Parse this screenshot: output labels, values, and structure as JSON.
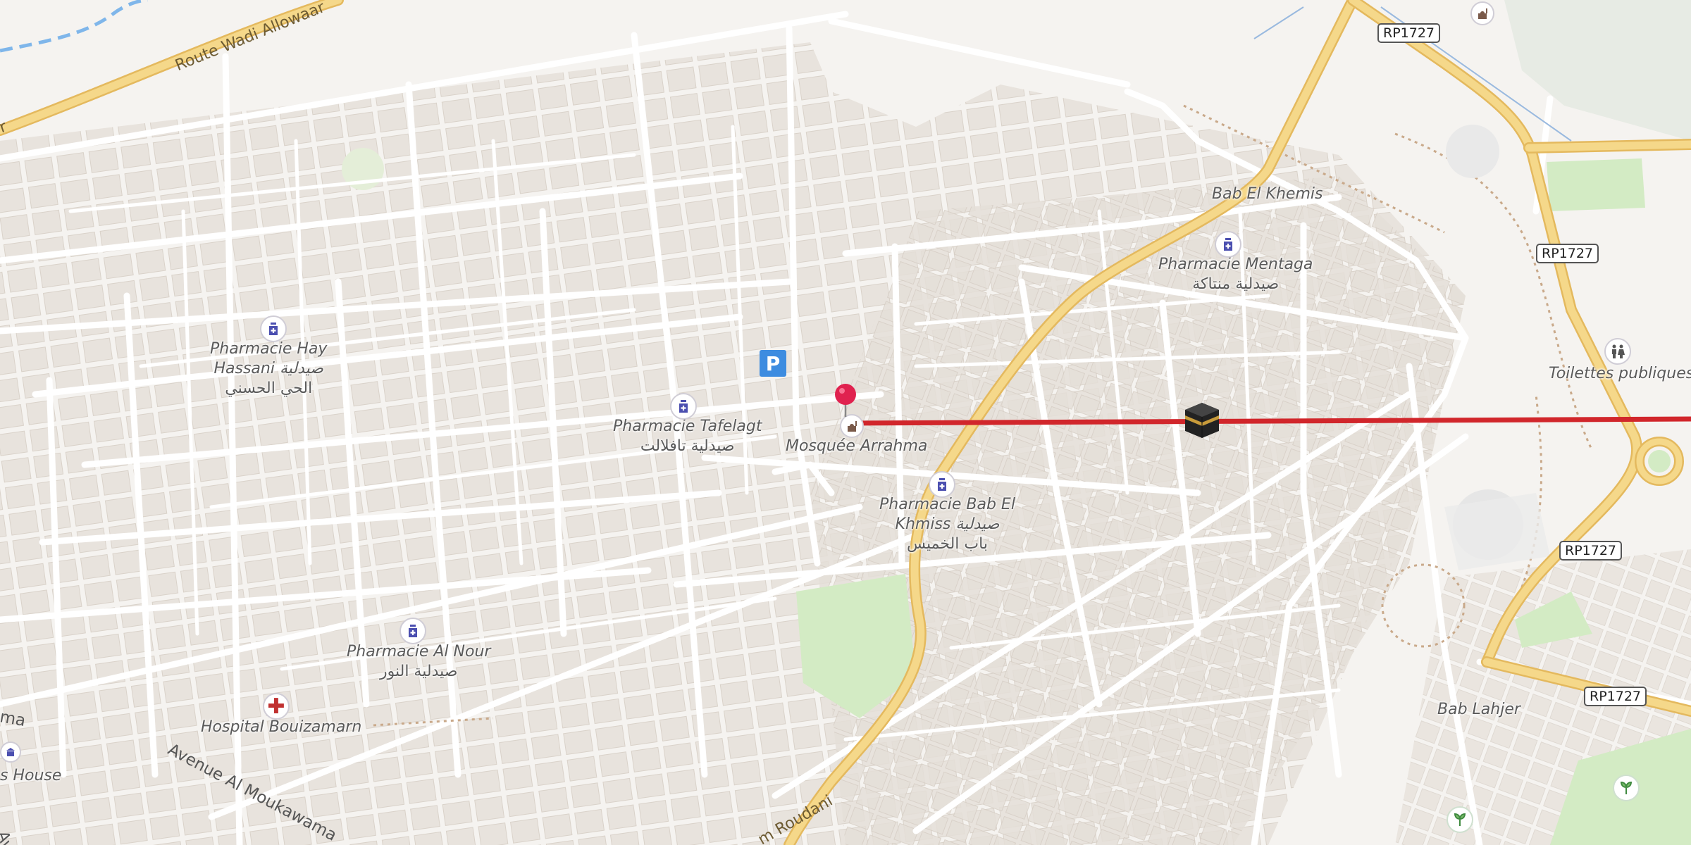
{
  "map": {
    "colors": {
      "land": "#f5f3f0",
      "building": "#e3ddd7",
      "building_edge": "#d4ccc4",
      "road_white": "#ffffff",
      "road_casing": "#e0dbd3",
      "main_road": "#f5d88a",
      "main_road_casing": "#e4b95e",
      "park": "#d3ebc4",
      "route_line": "#d1262b",
      "water": "#7fb6ea"
    },
    "roads": {
      "route_wadi_allowaar": "Route Wadi Allowaar",
      "avenue_al_moukawama": "Avenue Al Moukawama",
      "roudani": "m Roudani",
      "left_partial": "ma",
      "bottom_partial": "Ave",
      "road_fragment_r": "r"
    },
    "shields": {
      "rp1727_a": "RP1727",
      "rp1727_b": "RP1727",
      "rp1727_c": "RP1727",
      "rp1727_d": "RP1727"
    },
    "places": {
      "bab_el_khemis": "Bab El Khemis",
      "bab_lahjer": "Bab Lahjer",
      "toilettes": "Toilettes publiques",
      "mosquee": "Mosquée Arrahma",
      "hospital": "Hospital Bouizamarn",
      "house_partial": "s House"
    },
    "pharmacies": {
      "hay_hassani": {
        "fr1": "Pharmacie Hay",
        "fr2": "Hassani صيدلية",
        "ar": "الحي الحسني"
      },
      "tafelagt": {
        "fr": "Pharmacie Tafelagt",
        "ar": "صيدلية تافلالت"
      },
      "bab_el_khmiss": {
        "fr1": "Pharmacie Bab El",
        "fr2": "Khmiss صيدلية",
        "ar": "باب الخميس"
      },
      "mentaga": {
        "fr": "Pharmacie Mentaga",
        "ar": "صيدلية منتاكة"
      },
      "al_nour": {
        "fr": "Pharmacie Al Nour",
        "ar": "صيدلية النور"
      }
    },
    "icons": {
      "pharmacy": "pharmacy-icon",
      "hospital": "hospital-cross-icon",
      "parking": "parking-icon",
      "kaaba": "kaaba-icon",
      "pin": "location-pin-icon",
      "toilets": "toilets-icon",
      "garden": "garden-icon",
      "mosque": "mosque-icon"
    },
    "parking_glyph": "P",
    "hospital_glyph": "✚"
  }
}
